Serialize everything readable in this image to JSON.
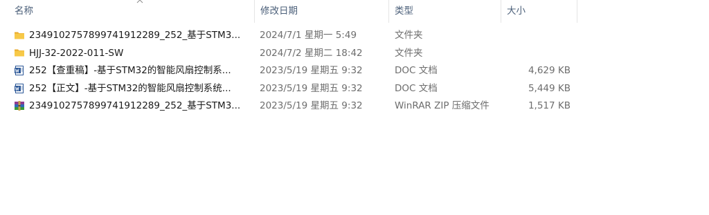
{
  "columns": {
    "name": "名称",
    "date": "修改日期",
    "type": "类型",
    "size": "大小"
  },
  "sort": {
    "column": "name",
    "direction": "ascending"
  },
  "files": [
    {
      "icon": "folder-icon",
      "name": "2349102757899741912289_252_基于STM3...",
      "date": "2024/7/1 星期一 5:49",
      "type": "文件夹",
      "size": ""
    },
    {
      "icon": "folder-icon",
      "name": "HJJ-32-2022-011-SW",
      "date": "2024/7/2 星期二 18:42",
      "type": "文件夹",
      "size": ""
    },
    {
      "icon": "word-doc-icon",
      "name": "252【查重稿】-基于STM32的智能风扇控制系...",
      "date": "2023/5/19 星期五 9:32",
      "type": "DOC 文档",
      "size": "4,629 KB"
    },
    {
      "icon": "word-doc-icon",
      "name": "252【正文】-基于STM32的智能风扇控制系统...",
      "date": "2023/5/19 星期五 9:32",
      "type": "DOC 文档",
      "size": "5,449 KB"
    },
    {
      "icon": "winrar-archive-icon",
      "name": "2349102757899741912289_252_基于STM3...",
      "date": "2023/5/19 星期五 9:32",
      "type": "WinRAR ZIP 压缩文件",
      "size": "1,517 KB"
    }
  ],
  "colors": {
    "header_text": "#4c607a",
    "folder": "#f5c242",
    "word_blue": "#2b5797"
  }
}
